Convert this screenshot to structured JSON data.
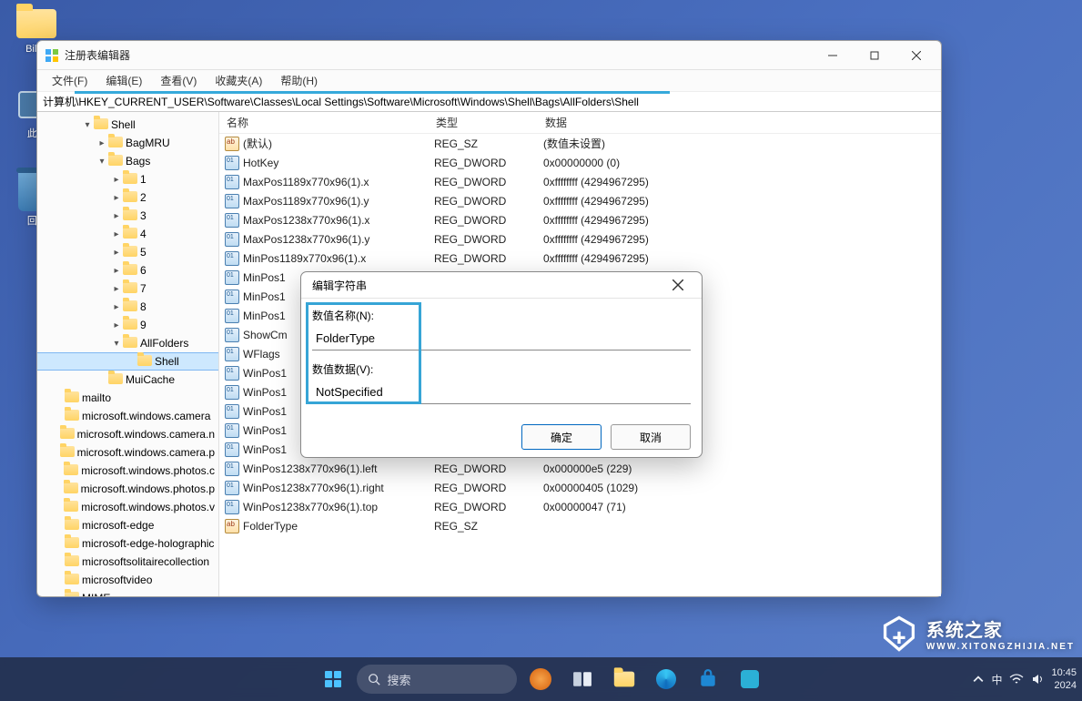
{
  "desktop": {
    "icon1_label": "Bill...",
    "icon2_label": "此...",
    "icon3_label": "回..."
  },
  "window": {
    "title": "注册表编辑器",
    "menus": [
      "文件(F)",
      "编辑(E)",
      "查看(V)",
      "收藏夹(A)",
      "帮助(H)"
    ],
    "address": "计算机\\HKEY_CURRENT_USER\\Software\\Classes\\Local Settings\\Software\\Microsoft\\Windows\\Shell\\Bags\\AllFolders\\Shell"
  },
  "tree": [
    {
      "depth": 3,
      "caret": "v",
      "label": "Shell"
    },
    {
      "depth": 4,
      "caret": ">",
      "label": "BagMRU"
    },
    {
      "depth": 4,
      "caret": "v",
      "label": "Bags"
    },
    {
      "depth": 5,
      "caret": ">",
      "label": "1"
    },
    {
      "depth": 5,
      "caret": ">",
      "label": "2"
    },
    {
      "depth": 5,
      "caret": ">",
      "label": "3"
    },
    {
      "depth": 5,
      "caret": ">",
      "label": "4"
    },
    {
      "depth": 5,
      "caret": ">",
      "label": "5"
    },
    {
      "depth": 5,
      "caret": ">",
      "label": "6"
    },
    {
      "depth": 5,
      "caret": ">",
      "label": "7"
    },
    {
      "depth": 5,
      "caret": ">",
      "label": "8"
    },
    {
      "depth": 5,
      "caret": ">",
      "label": "9"
    },
    {
      "depth": 5,
      "caret": "v",
      "label": "AllFolders"
    },
    {
      "depth": 6,
      "caret": "",
      "label": "Shell",
      "selected": true
    },
    {
      "depth": 4,
      "caret": "",
      "label": "MuiCache"
    },
    {
      "depth": 1,
      "caret": "",
      "label": "mailto"
    },
    {
      "depth": 1,
      "caret": "",
      "label": "microsoft.windows.camera"
    },
    {
      "depth": 1,
      "caret": "",
      "label": "microsoft.windows.camera.n"
    },
    {
      "depth": 1,
      "caret": "",
      "label": "microsoft.windows.camera.p"
    },
    {
      "depth": 1,
      "caret": "",
      "label": "microsoft.windows.photos.c"
    },
    {
      "depth": 1,
      "caret": "",
      "label": "microsoft.windows.photos.p"
    },
    {
      "depth": 1,
      "caret": "",
      "label": "microsoft.windows.photos.v"
    },
    {
      "depth": 1,
      "caret": "",
      "label": "microsoft-edge"
    },
    {
      "depth": 1,
      "caret": "",
      "label": "microsoft-edge-holographic"
    },
    {
      "depth": 1,
      "caret": "",
      "label": "microsoftsolitairecollection"
    },
    {
      "depth": 1,
      "caret": "",
      "label": "microsoftvideo"
    },
    {
      "depth": 1,
      "caret": ">",
      "label": "MIME"
    }
  ],
  "columns": {
    "name": "名称",
    "type": "类型",
    "data": "数据"
  },
  "rows": [
    {
      "icon": "sz",
      "name": "(默认)",
      "type": "REG_SZ",
      "data": "(数值未设置)"
    },
    {
      "icon": "bin",
      "name": "HotKey",
      "type": "REG_DWORD",
      "data": "0x00000000 (0)"
    },
    {
      "icon": "bin",
      "name": "MaxPos1189x770x96(1).x",
      "type": "REG_DWORD",
      "data": "0xffffffff (4294967295)"
    },
    {
      "icon": "bin",
      "name": "MaxPos1189x770x96(1).y",
      "type": "REG_DWORD",
      "data": "0xffffffff (4294967295)"
    },
    {
      "icon": "bin",
      "name": "MaxPos1238x770x96(1).x",
      "type": "REG_DWORD",
      "data": "0xffffffff (4294967295)"
    },
    {
      "icon": "bin",
      "name": "MaxPos1238x770x96(1).y",
      "type": "REG_DWORD",
      "data": "0xffffffff (4294967295)"
    },
    {
      "icon": "bin",
      "name": "MinPos1189x770x96(1).x",
      "type": "REG_DWORD",
      "data": "0xffffffff (4294967295)"
    },
    {
      "icon": "bin",
      "name": "MinPos1",
      "type": "",
      "data": ""
    },
    {
      "icon": "bin",
      "name": "MinPos1",
      "type": "",
      "data": ""
    },
    {
      "icon": "bin",
      "name": "MinPos1",
      "type": "",
      "data": ""
    },
    {
      "icon": "bin",
      "name": "ShowCm",
      "type": "",
      "data": ""
    },
    {
      "icon": "bin",
      "name": "WFlags",
      "type": "",
      "data": ""
    },
    {
      "icon": "bin",
      "name": "WinPos1",
      "type": "",
      "data": ""
    },
    {
      "icon": "bin",
      "name": "WinPos1",
      "type": "",
      "data": ""
    },
    {
      "icon": "bin",
      "name": "WinPos1",
      "type": "",
      "data": ""
    },
    {
      "icon": "bin",
      "name": "WinPos1",
      "type": "",
      "data": ""
    },
    {
      "icon": "bin",
      "name": "WinPos1",
      "type": "",
      "data": ""
    },
    {
      "icon": "bin",
      "name": "WinPos1238x770x96(1).left",
      "type": "REG_DWORD",
      "data": "0x000000e5 (229)"
    },
    {
      "icon": "bin",
      "name": "WinPos1238x770x96(1).right",
      "type": "REG_DWORD",
      "data": "0x00000405 (1029)"
    },
    {
      "icon": "bin",
      "name": "WinPos1238x770x96(1).top",
      "type": "REG_DWORD",
      "data": "0x00000047 (71)"
    },
    {
      "icon": "sz",
      "name": "FolderType",
      "type": "REG_SZ",
      "data": ""
    }
  ],
  "dialog": {
    "title": "编辑字符串",
    "name_label": "数值名称(N):",
    "name_value": "FolderType",
    "data_label": "数值数据(V):",
    "data_value": "NotSpecified",
    "ok": "确定",
    "cancel": "取消"
  },
  "taskbar": {
    "search_text": "搜索",
    "tray_lang": "中",
    "tray_time": "10:45",
    "tray_date": "2024"
  },
  "watermark": {
    "text": "系统之家",
    "url": "WWW.XITONGZHIJIA.NET"
  }
}
